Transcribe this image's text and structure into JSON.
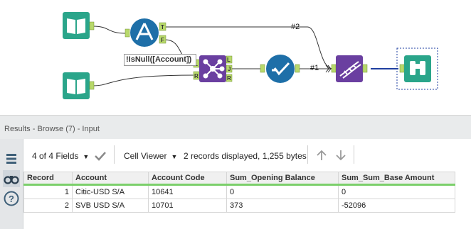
{
  "canvas": {
    "formula_label": "!IsNull([Account])",
    "connection_labels": [
      "#2",
      "#1"
    ],
    "anchor_labels": {
      "filter_true": "T",
      "filter_false": "F",
      "join_left": "L",
      "join_inner": "J",
      "join_right": "R",
      "join_in_left": "L",
      "join_in_right": "R"
    }
  },
  "results": {
    "title": "Results - Browse (7) - Input",
    "fields_selector": "4 of 4 Fields",
    "viewer_selector": "Cell Viewer",
    "summary": "2 records displayed, 1,255 bytes"
  },
  "grid": {
    "columns": [
      "Record",
      "Account",
      "Account Code",
      "Sum_Opening Balance",
      "Sum_Sum_Base Amount"
    ],
    "rows": [
      [
        "1",
        "Citic-USD S/A",
        "10641",
        "0",
        "0"
      ],
      [
        "2",
        "SVB USD S/A",
        "10701",
        "373",
        "-52096"
      ]
    ]
  },
  "colors": {
    "input_tool": "#2aa58a",
    "filter_tool": "#1e6fa8",
    "join_tool": "#6a3fa0",
    "select_tool": "#1e6fa8",
    "transform_tool": "#6a3fa0",
    "browse_tool": "#2aa58a",
    "anchor": "#b8d96b",
    "header_accent": "#7bcf6a"
  },
  "icons": {
    "input1": "book-icon",
    "input2": "book-icon",
    "filter": "filter-icon",
    "join": "join-icon",
    "select": "check-icon",
    "transform": "dna-icon",
    "browse": "binoculars-icon",
    "rail": [
      "list-icon",
      "binoculars-icon",
      "help-icon"
    ]
  }
}
